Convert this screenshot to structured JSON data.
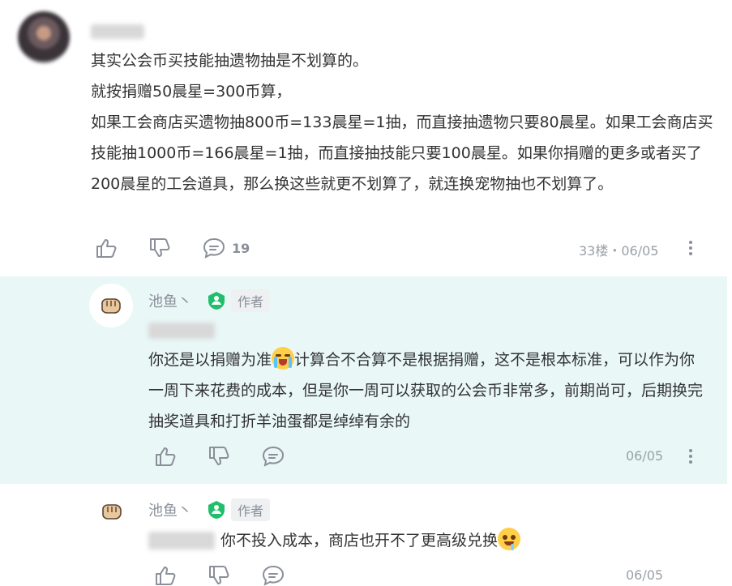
{
  "main_comment": {
    "lines": [
      "其实公会币买技能抽遗物抽是不划算的。",
      "就按捐赠50晨星=300币算，",
      "如果工会商店买遗物抽800币=133晨星=1抽，而直接抽遗物只要80晨星。如果工会商店买技能抽1000币=166晨星=1抽，而直接抽技能只要100晨星。如果你捐赠的更多或者买了200晨星的工会道具，那么换这些就更不划算了，就连换宠物抽也不划算了。"
    ],
    "actions": {
      "reply_count": "19"
    },
    "meta": "33楼・06/05"
  },
  "reply1": {
    "username": "池鱼丶",
    "author_tag": "作者",
    "text_a": "你还是以捐赠为准",
    "text_b": "计算合不合算不是根据捐赠，这不是根本标准，可以作为你一周下来花费的成本，但是你一周可以获取的公会币非常多，前期尚可，后期换完抽奖道具和打折羊油蛋都是绰绰有余的",
    "date": "06/05"
  },
  "reply2": {
    "username": "池鱼丶",
    "author_tag": "作者",
    "text": "你不投入成本，商店也开不了更高级兑换",
    "date": "06/05"
  },
  "colors": {
    "reply_bg": "#e9f7f7",
    "author_badge_green": "#1fbf6b",
    "icon_gray": "#8a8f99"
  }
}
